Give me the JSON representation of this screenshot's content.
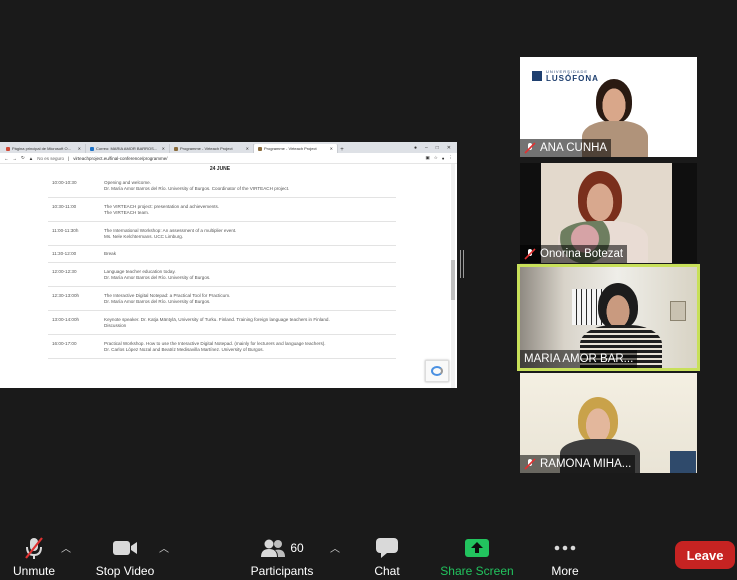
{
  "browser": {
    "tabs": [
      {
        "label": "Página principal de Microsoft O..."
      },
      {
        "label": "Correo: MARIA AMOR BARROS..."
      },
      {
        "label": "Programme - Virteach Project"
      },
      {
        "label": "Programme - Virteach Project"
      }
    ],
    "new_tab": "+",
    "address": {
      "security": "No es seguro",
      "url": "virteachproject.eu/final-conference/programme/"
    }
  },
  "programme": {
    "day": "24 JUNE",
    "rows": [
      {
        "time": "10:00-10:30",
        "lines": [
          "Opening and welcome.",
          "Dr. María Amor Barros del Río. University of Burgos. Coordinator of the VIRTEACH project."
        ]
      },
      {
        "time": "10:30-11:00",
        "lines": [
          "The VIRTEACH project: presentation and achievements.",
          "The VIRTEACH team."
        ]
      },
      {
        "time": "11:00-11:30h",
        "lines": [
          "The International Workshop: An assessment of a multiplier event.",
          "Ms. Nele Kelchtermans. UCC Limburg."
        ]
      },
      {
        "time": "11:30-12:00",
        "lines": [
          "Break"
        ]
      },
      {
        "time": "12:00-12:30",
        "lines": [
          "Language teacher education today.",
          "Dr. María Amor Barros del Río. University of Burgos."
        ]
      },
      {
        "time": "12:30-13:00h",
        "lines": [
          "The Interactive Digital Notepad: a Practical Tool for Practicum.",
          "Dr. María Amor Barros del Río. University of Burgos."
        ]
      },
      {
        "time": "13:00-14:00h",
        "lines": [
          "Keynote speaker. Dr. Katja Mäntylä, University of Turku. Finland. Training foreign language teachers in Finland.",
          "Discussion"
        ]
      },
      {
        "time": "16:00-17:00",
        "lines": [
          "Practical Workshop. How to use the Interactive Digital Notepad. (mainly for lecturers and language teachers).",
          "Dr. Carlos López Nozal and Beatriz Medisavilla Martínez. University of Burgos."
        ]
      }
    ]
  },
  "participants": [
    {
      "name": "ANA CUNHA",
      "logo_small": "UNIVERSIDADE",
      "logo_big": "LUSÓFONA"
    },
    {
      "name": "Onorina Botezat"
    },
    {
      "name": "MARIA AMOR BAR..."
    },
    {
      "name": "RAMONA MIHA..."
    }
  ],
  "toolbar": {
    "unmute": "Unmute",
    "stop_video": "Stop Video",
    "participants": "Participants",
    "participants_count": "60",
    "chat": "Chat",
    "share_screen": "Share Screen",
    "more": "More",
    "leave": "Leave"
  },
  "colors": {
    "active_speaker_border": "#c8e05a",
    "share_green": "#22c35e",
    "leave_red": "#c62322"
  }
}
